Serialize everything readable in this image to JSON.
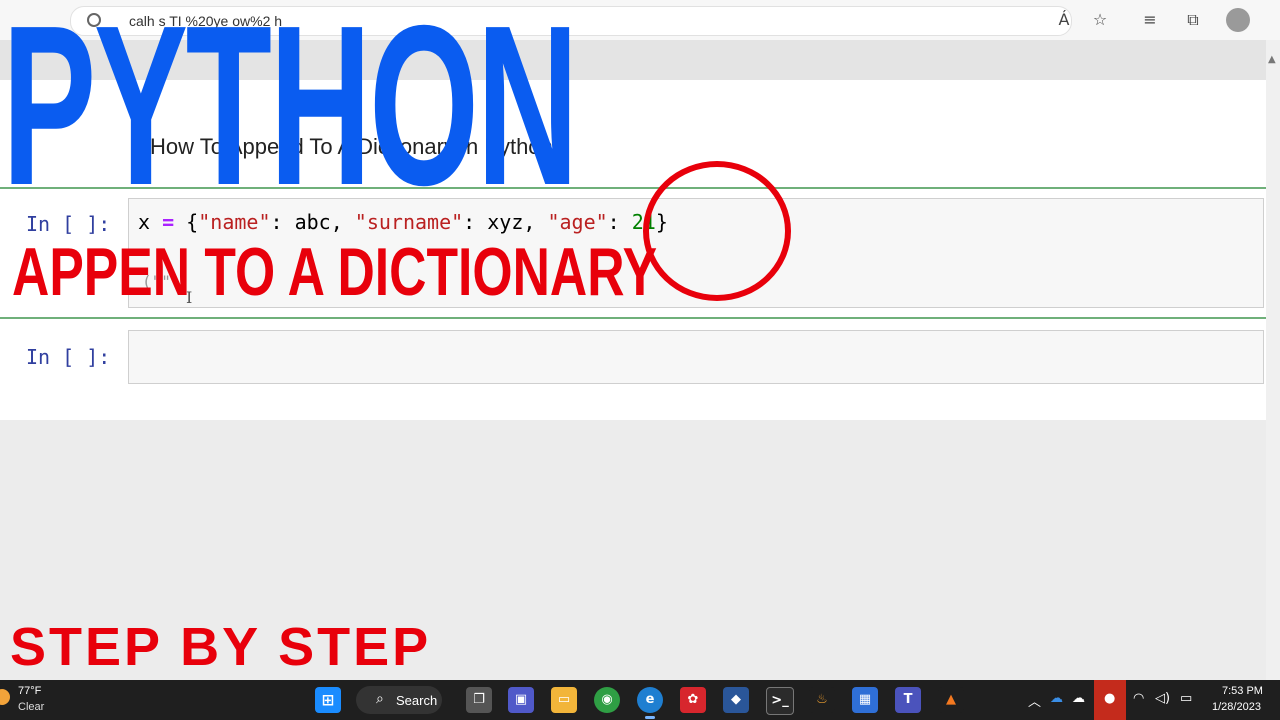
{
  "browser": {
    "url_text": "calh          s          TI    %20ye    ow%2     h",
    "read_aloud_icon": "Á",
    "favorite_icon": "☆",
    "favorites_list_icon": "≡",
    "collections_icon": "⧉"
  },
  "notebook": {
    "markdown_heading": "How To Append To A Dictionary in Python:",
    "cell1_prompt": "In [ ]:",
    "cell1_code": {
      "var": "x ",
      "op": "=",
      "open": " {",
      "k1": "\"name\"",
      "sep1": ": abc, ",
      "k2": "\"surname\"",
      "sep2": ": xyz, ",
      "k3": "\"age\"",
      "sep3": ": ",
      "v3": "21",
      "close": "}"
    },
    "cell1_line2": "(\"\"",
    "cell2_prompt": "In [ ]:"
  },
  "overlay": {
    "title": "PYTHON",
    "subtitle": "APPEN TO A DICTIONARY",
    "footer": "STEP BY STEP"
  },
  "taskbar": {
    "weather_temp": "77°F",
    "weather_condition": "Clear",
    "search_label": "Search",
    "clock_time": "7:53 PM",
    "clock_date": "1/28/2023"
  },
  "colors": {
    "title_blue": "#0a5cf0",
    "overlay_red": "#e8000b",
    "prompt_blue": "#303f9f"
  }
}
